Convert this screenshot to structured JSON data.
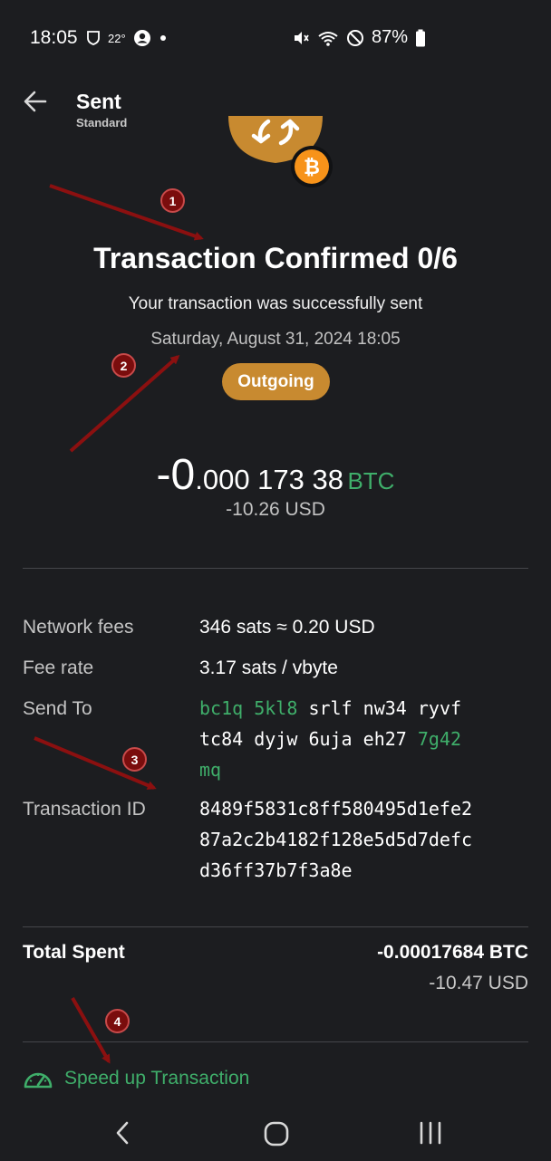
{
  "status_bar": {
    "time": "18:05",
    "temperature": "22°",
    "battery": "87%",
    "icons": [
      "shield-icon",
      "account-circle-icon",
      "dot-icon",
      "mute-icon",
      "wifi-icon",
      "do-not-disturb-icon",
      "battery-icon"
    ]
  },
  "header": {
    "title": "Sent",
    "subtitle": "Standard"
  },
  "hero": {
    "title": "Transaction Confirmed 0/6",
    "message": "Your transaction was successfully sent",
    "date": "Saturday, August 31, 2024 18:05",
    "badge": "Outgoing",
    "badge_color": "#c88a30"
  },
  "amount": {
    "big": "-0",
    "rest": ".000 173 38",
    "unit": "BTC",
    "usd": "-10.26 USD"
  },
  "details": {
    "network_fees_label": "Network fees",
    "network_fees_value": "346 sats ≈ 0.20 USD",
    "fee_rate_label": "Fee rate",
    "fee_rate_value": "3.17 sats / vbyte",
    "send_to_label": "Send To",
    "send_to_line1": [
      "bc1q",
      "5kl8",
      "srlf",
      "nw34",
      "ryvf"
    ],
    "send_to_line2": [
      "tc84",
      "dyjw",
      "6uja",
      "eh27",
      "7g42"
    ],
    "send_to_line3": [
      "mq"
    ],
    "txid_label": "Transaction ID",
    "txid_line1": "8489f5831c8ff580495d1efe2",
    "txid_line2": "87a2c2b4182f128e5d5d7defc",
    "txid_line3": "d36ff37b7f3a8e"
  },
  "total": {
    "label": "Total Spent",
    "btc": "-0.00017684 BTC",
    "usd": "-10.47 USD"
  },
  "speed_up": {
    "label": "Speed up Transaction"
  },
  "annotations": [
    "1",
    "2",
    "3",
    "4"
  ],
  "colors": {
    "background": "#1c1d20",
    "accent_green": "#3fae6a",
    "bitcoin_orange": "#f7931a",
    "marker_red": "#7a0d0d",
    "arrow_red": "#8b1010"
  }
}
